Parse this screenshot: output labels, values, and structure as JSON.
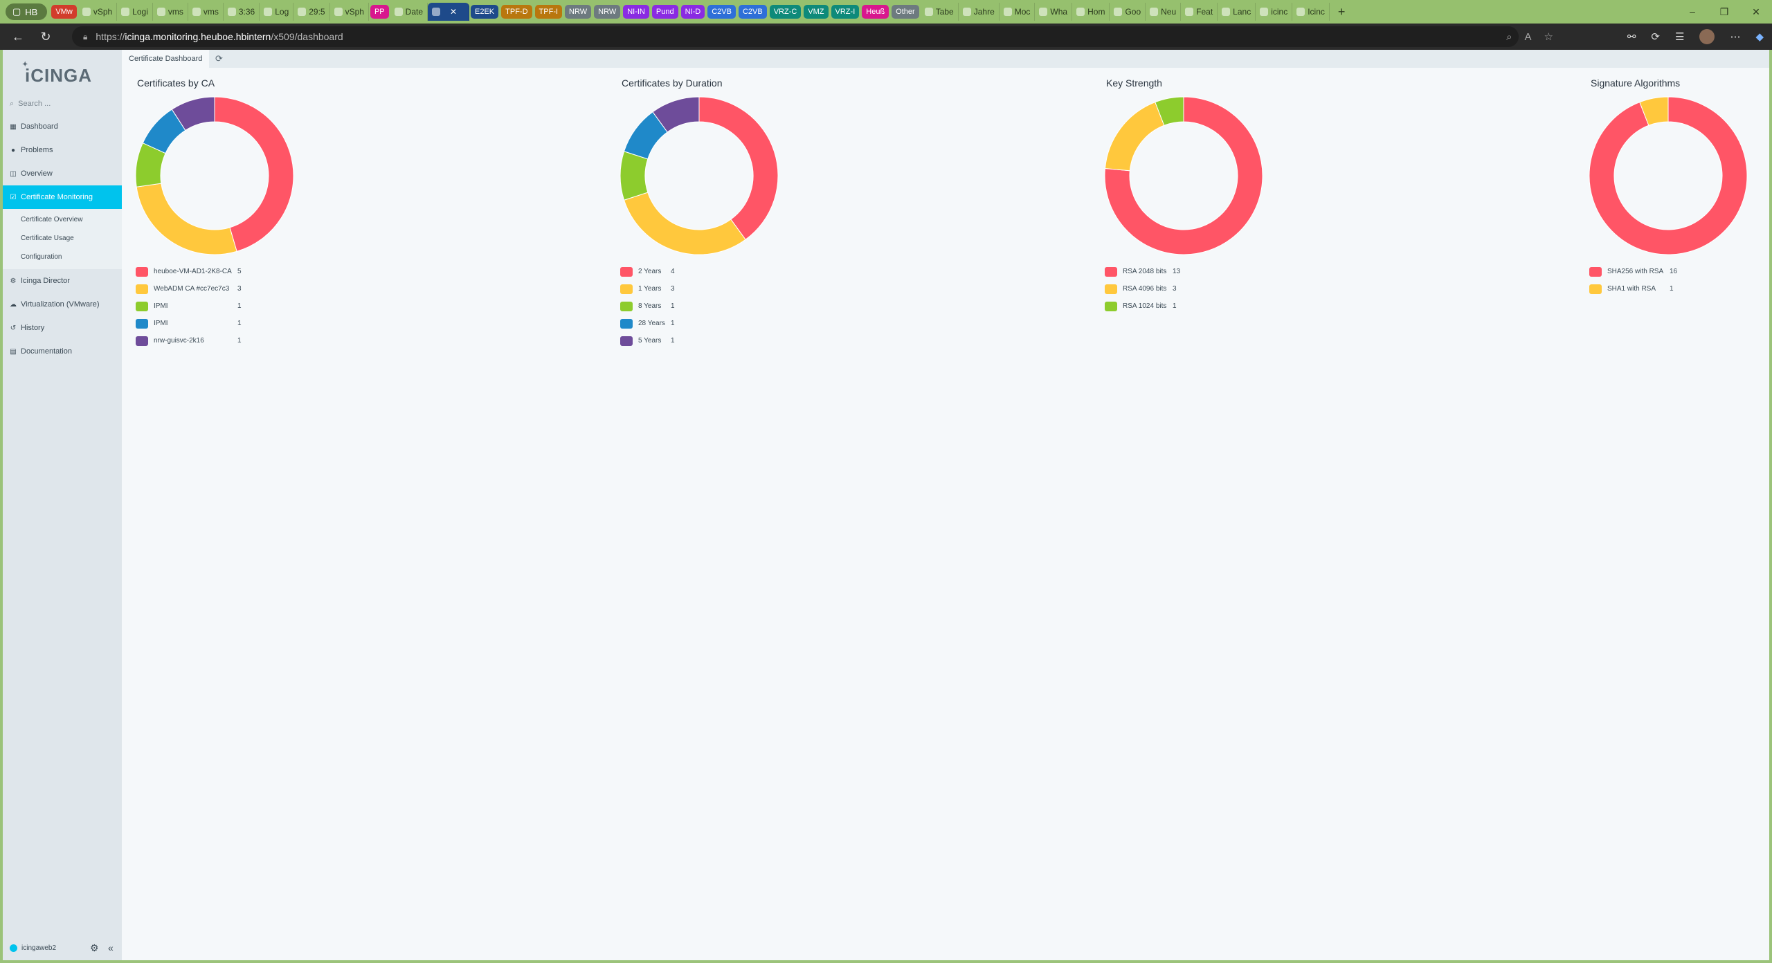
{
  "browser": {
    "profile_label": "HB",
    "tabs": [
      {
        "label": "VMw",
        "chip": true,
        "color": "#d23c2c"
      },
      {
        "label": "vSph"
      },
      {
        "label": "Logi"
      },
      {
        "label": "vms"
      },
      {
        "label": "vms"
      },
      {
        "label": "3:36"
      },
      {
        "label": "Log"
      },
      {
        "label": "29:5"
      },
      {
        "label": "vSph"
      },
      {
        "label": "PP",
        "chip": true,
        "color": "#d8178e"
      },
      {
        "label": "Date"
      },
      {
        "label": "",
        "active": true
      },
      {
        "label": "E2EK",
        "chip": true,
        "color": "#1e4a8a"
      },
      {
        "label": "TPF-D",
        "chip": true,
        "color": "#b9770e"
      },
      {
        "label": "TPF-I",
        "chip": true,
        "color": "#b9770e"
      },
      {
        "label": "NRW",
        "chip": true,
        "color": "#6d7a7f"
      },
      {
        "label": "NRW",
        "chip": true,
        "color": "#6d7a7f"
      },
      {
        "label": "NI-IN",
        "chip": true,
        "color": "#8a2be2"
      },
      {
        "label": "Pund",
        "chip": true,
        "color": "#8a2be2"
      },
      {
        "label": "NI-D",
        "chip": true,
        "color": "#8a2be2"
      },
      {
        "label": "C2VB",
        "chip": true,
        "color": "#2e6fd8"
      },
      {
        "label": "C2VB",
        "chip": true,
        "color": "#2e6fd8"
      },
      {
        "label": "VRZ-C",
        "chip": true,
        "color": "#0e8a7a"
      },
      {
        "label": "VMZ",
        "chip": true,
        "color": "#0e8a7a"
      },
      {
        "label": "VRZ-I",
        "chip": true,
        "color": "#0e8a7a"
      },
      {
        "label": "Heuß",
        "chip": true,
        "color": "#d8178e"
      },
      {
        "label": "Other",
        "chip": true,
        "color": "#6d7a7f"
      },
      {
        "label": "Tabe"
      },
      {
        "label": "Jahre"
      },
      {
        "label": "Moc"
      },
      {
        "label": "Wha"
      },
      {
        "label": "Hom"
      },
      {
        "label": "Goo"
      },
      {
        "label": "Neu"
      },
      {
        "label": "Feat"
      },
      {
        "label": "Lanc"
      },
      {
        "label": "icinc"
      },
      {
        "label": "Icinc"
      }
    ],
    "url_prefix": "https://",
    "url_host": "icinga.monitoring.heuboe.hbintern",
    "url_path": "/x509/dashboard"
  },
  "sidebar": {
    "logo_text": "iCINGA",
    "search_placeholder": "Search ...",
    "items": [
      {
        "label": "Dashboard",
        "icon": "dashboard-icon",
        "glyph": "▦"
      },
      {
        "label": "Problems",
        "icon": "problems-icon",
        "glyph": "●"
      },
      {
        "label": "Overview",
        "icon": "binoculars-icon",
        "glyph": "◫"
      },
      {
        "label": "Certificate Monitoring",
        "icon": "certificate-icon",
        "glyph": "☑",
        "active": true
      },
      {
        "label": "Icinga Director",
        "icon": "director-icon",
        "glyph": "⚙"
      },
      {
        "label": "Virtualization (VMware)",
        "icon": "cloud-icon",
        "glyph": "☁"
      },
      {
        "label": "History",
        "icon": "history-icon",
        "glyph": "↺"
      },
      {
        "label": "Documentation",
        "icon": "book-icon",
        "glyph": "▤"
      }
    ],
    "submenu": [
      "Certificate Overview",
      "Certificate Usage",
      "Configuration"
    ],
    "footer_user": "icingaweb2"
  },
  "main": {
    "tab_label": "Certificate Dashboard"
  },
  "colors": [
    "#ff5566",
    "#ffc83d",
    "#8dcc2d",
    "#1f89c9",
    "#6e4c9a"
  ],
  "chart_data": [
    {
      "type": "pie",
      "title": "Certificates by CA",
      "categories": [
        "heuboe-VM-AD1-2K8-CA",
        "WebADM CA #cc7ec7c3",
        "IPMI",
        "IPMI",
        "nrw-guisvc-2k16"
      ],
      "values": [
        5,
        3,
        1,
        1,
        1
      ]
    },
    {
      "type": "pie",
      "title": "Certificates by Duration",
      "categories": [
        "2 Years",
        "1 Years",
        "8 Years",
        "28 Years",
        "5 Years"
      ],
      "values": [
        4,
        3,
        1,
        1,
        1
      ]
    },
    {
      "type": "pie",
      "title": "Key Strength",
      "categories": [
        "RSA 2048 bits",
        "RSA 4096 bits",
        "RSA 1024 bits"
      ],
      "values": [
        13,
        3,
        1
      ]
    },
    {
      "type": "pie",
      "title": "Signature Algorithms",
      "categories": [
        "SHA256 with RSA",
        "SHA1 with RSA"
      ],
      "values": [
        16,
        1
      ]
    }
  ]
}
